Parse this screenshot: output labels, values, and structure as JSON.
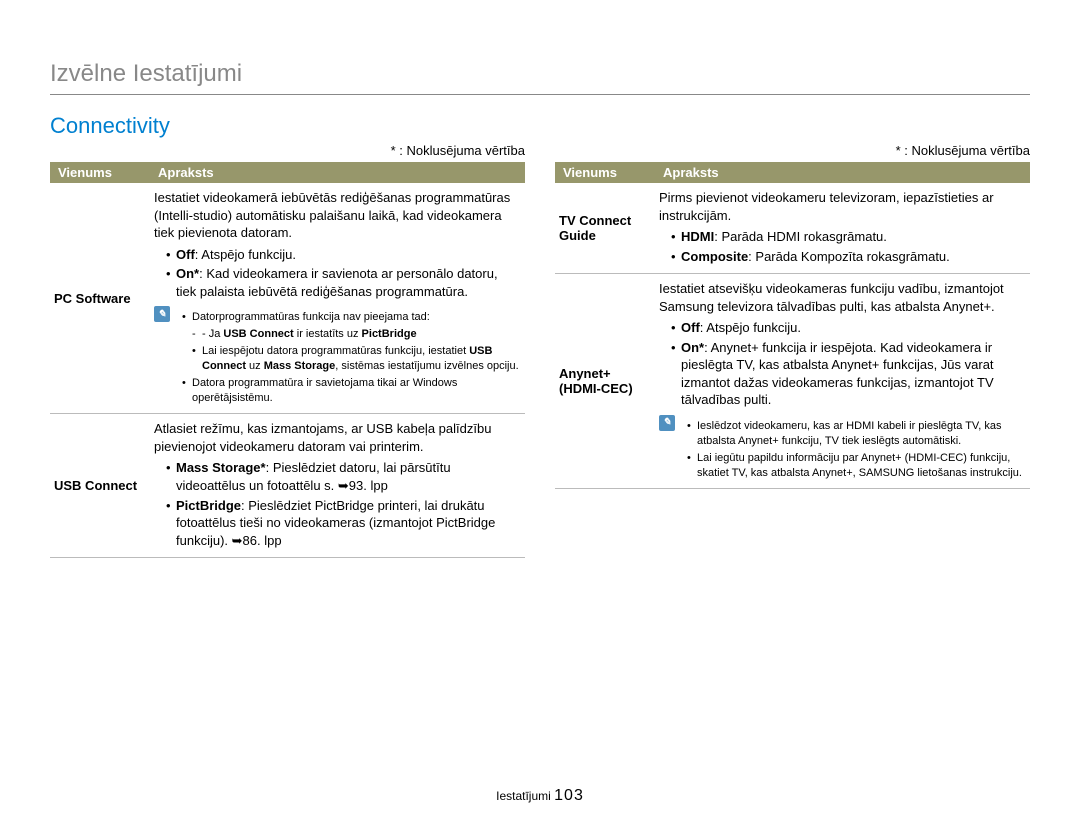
{
  "page_title": "Izvēlne Iestatījumi",
  "section_title": "Connectivity",
  "default_note": "* : Noklusējuma vērtība",
  "header_item": "Vienums",
  "header_desc": "Apraksts",
  "note_icon": "✎",
  "left": {
    "r1_name": "PC Software",
    "r1_p1": "Iestatiet videokamerā iebūvētās rediģēšanas programmatūras (Intelli-studio) automātisku palaišanu laikā, kad videokamera tiek pievienota datoram.",
    "r1_b1a": "Off",
    "r1_b1b": ": Atspējo funkciju.",
    "r1_b2a": "On*",
    "r1_b2b": ": Kad videokamera ir savienota ar personālo datoru, tiek palaista iebūvētā rediģēšanas programmatūra.",
    "r1_n1": "Datorprogrammatūras funkcija nav pieejama tad:",
    "r1_n2a": "- Ja ",
    "r1_n2b": "USB Connect",
    "r1_n2c": " ir iestatīts uz ",
    "r1_n2d": "PictBridge",
    "r1_n3a": "Lai iespējotu datora programmatūras funkciju, iestatiet ",
    "r1_n3b": "USB Connect",
    "r1_n3c": " uz ",
    "r1_n3d": "Mass Storage",
    "r1_n3e": ", sistēmas iestatījumu izvēlnes opciju.",
    "r1_n4": "Datora programmatūra ir savietojama tikai ar Windows operētājsistēmu.",
    "r2_name": "USB Connect",
    "r2_p1": "Atlasiet režīmu, kas izmantojams, ar USB kabeļa palīdzību pievienojot videokameru datoram vai printerim.",
    "r2_b1a": "Mass Storage*",
    "r2_b1b": ": Pieslēdziet datoru, lai pārsūtītu videoattēlus un fotoattēlu s. ➥93. lpp",
    "r2_b2a": "PictBridge",
    "r2_b2b": ": Pieslēdziet PictBridge printeri, lai drukātu fotoattēlus tieši no videokameras (izmantojot PictBridge funkciju). ➥86. lpp"
  },
  "right": {
    "r1_name": "TV Connect Guide",
    "r1_p1": "Pirms pievienot videokameru televizoram, iepazīstieties ar instrukcijām.",
    "r1_b1a": "HDMI",
    "r1_b1b": ": Parāda HDMI rokasgrāmatu.",
    "r1_b2a": "Composite",
    "r1_b2b": ": Parāda Kompozīta rokasgrāmatu.",
    "r2_name": "Anynet+ (HDMI-CEC)",
    "r2_p1": "Iestatiet atsevišķu videokameras funkciju vadību, izmantojot Samsung televizora tālvadības pulti, kas atbalsta Anynet+.",
    "r2_b1a": "Off",
    "r2_b1b": ": Atspējo funkciju.",
    "r2_b2a": "On*",
    "r2_b2b": ": Anynet+ funkcija ir iespējota. Kad videokamera ir pieslēgta TV, kas atbalsta Anynet+ funkcijas, Jūs varat izmantot dažas videokameras funkcijas, izmantojot TV tālvadības pulti.",
    "r2_n1": "Ieslēdzot videokameru, kas ar HDMI kabeli ir pieslēgta TV, kas atbalsta Anynet+ funkciju, TV tiek ieslēgts automātiski.",
    "r2_n2": "Lai iegūtu papildu informāciju par Anynet+ (HDMI-CEC) funkciju, skatiet TV, kas atbalsta Anynet+, SAMSUNG lietošanas instrukciju."
  },
  "footer_label": "Iestatījumi ",
  "footer_page": "103"
}
